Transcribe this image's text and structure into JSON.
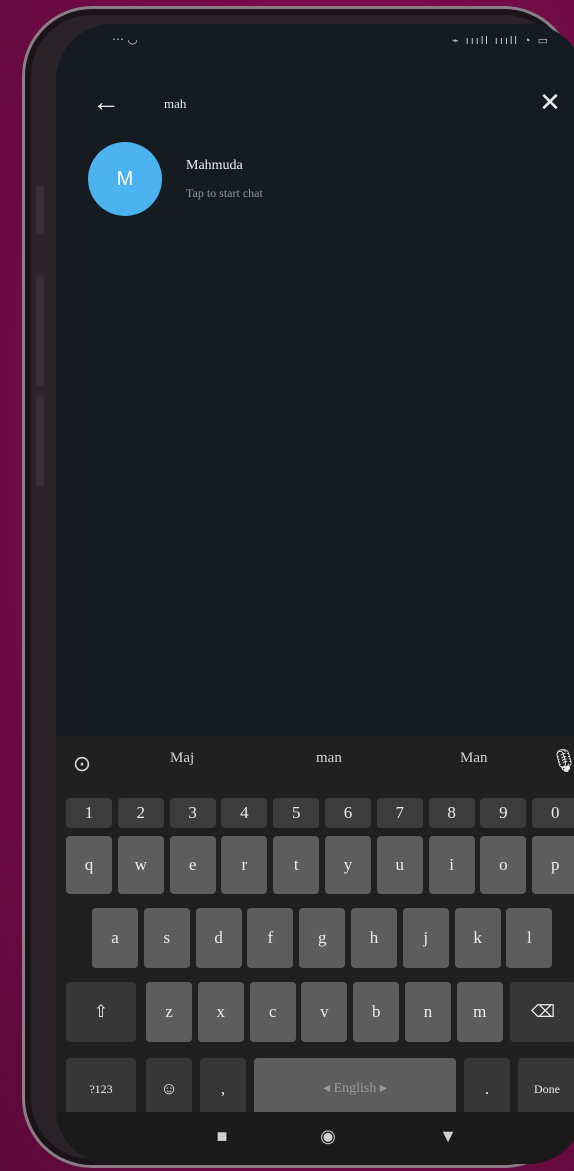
{
  "status_bar": {
    "left": "⋯ ◡",
    "right": "⌁ ıııll ıııll ◔ ▭"
  },
  "search": {
    "query": "mah",
    "back_glyph": "←",
    "close_glyph": "✕"
  },
  "result": {
    "avatar_letter": "M",
    "name": "Mahmuda",
    "subtitle": "Tap to start chat",
    "avatar_color": "#4bb3f0"
  },
  "keyboard": {
    "suggestions": [
      "Maj",
      "man",
      "Man"
    ],
    "number_row": [
      "1",
      "2",
      "3",
      "4",
      "5",
      "6",
      "7",
      "8",
      "9",
      "0"
    ],
    "row1": [
      "q",
      "w",
      "e",
      "r",
      "t",
      "y",
      "u",
      "i",
      "o",
      "p"
    ],
    "row2": [
      "a",
      "s",
      "d",
      "f",
      "g",
      "h",
      "j",
      "k",
      "l"
    ],
    "row3": [
      "z",
      "x",
      "c",
      "v",
      "b",
      "n",
      "m"
    ],
    "shift_glyph": "⇧",
    "backspace_glyph": "⌫",
    "mode_key": "?123",
    "emoji_glyph": "☺",
    "comma": ",",
    "space_label": "◂  English  ▸",
    "period": ".",
    "done_label": "Done",
    "mic_glyph": "🎙",
    "clipboard_glyph": "⊙"
  },
  "nav": {
    "recent": "■",
    "home": "◉",
    "back": "▼"
  }
}
